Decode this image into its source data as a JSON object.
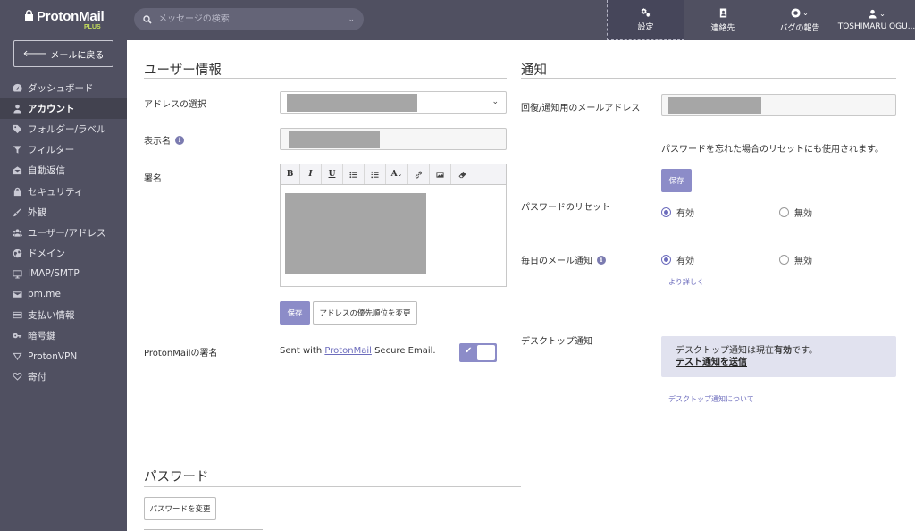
{
  "app": {
    "brand": "ProtonMail",
    "plan": "PLUS",
    "back_label": "メールに戻る"
  },
  "sidebar": {
    "items": [
      {
        "label": "ダッシュボード",
        "icon": "dashboard-icon",
        "active": false
      },
      {
        "label": "アカウント",
        "icon": "user-icon",
        "active": true
      },
      {
        "label": "フォルダー/ラベル",
        "icon": "tag-icon",
        "active": false
      },
      {
        "label": "フィルター",
        "icon": "filter-icon",
        "active": false
      },
      {
        "label": "自動返信",
        "icon": "envelope-open-icon",
        "active": false
      },
      {
        "label": "セキュリティ",
        "icon": "lock-icon",
        "active": false
      },
      {
        "label": "外観",
        "icon": "brush-icon",
        "active": false
      },
      {
        "label": "ユーザー/アドレス",
        "icon": "users-icon",
        "active": false
      },
      {
        "label": "ドメイン",
        "icon": "globe-icon",
        "active": false
      },
      {
        "label": "IMAP/SMTP",
        "icon": "monitor-icon",
        "active": false
      },
      {
        "label": "pm.me",
        "icon": "envelope-icon",
        "active": false
      },
      {
        "label": "支払い情報",
        "icon": "credit-card-icon",
        "active": false
      },
      {
        "label": "暗号鍵",
        "icon": "key-icon",
        "active": false
      },
      {
        "label": "ProtonVPN",
        "icon": "vpn-icon",
        "active": false
      },
      {
        "label": "寄付",
        "icon": "heart-icon",
        "active": false
      }
    ]
  },
  "topbar": {
    "search_placeholder": "メッセージの検索",
    "settings_label": "設定",
    "contacts_label": "連絡先",
    "bug_label": "バグの報告",
    "user_label": "TOSHIMARU OGU..."
  },
  "user_info": {
    "title": "ユーザー情報",
    "address_label": "アドレスの選択",
    "display_name_label": "表示名",
    "signature_label": "署名",
    "save_label": "保存",
    "address_priority_label": "アドレスの優先順位を変更",
    "protonmail_sig_label": "ProtonMailの署名",
    "sig_prefix": "Sent with ",
    "sig_link": "ProtonMail",
    "sig_suffix": " Secure Email.",
    "sig_toggle_on": true,
    "toolbar": [
      "B",
      "I",
      "U",
      "bullet-list-icon",
      "numbered-list-icon",
      "A",
      "link-icon",
      "image-icon",
      "eraser-icon"
    ]
  },
  "notifications": {
    "title": "通知",
    "recovery_email_label": "回復/通知用のメールアドレス",
    "recovery_hint": "パスワードを忘れた場合のリセットにも使用されます。",
    "save_label": "保存",
    "password_reset_label": "パスワードのリセット",
    "daily_label": "毎日のメール通知",
    "enabled_label": "有効",
    "disabled_label": "無効",
    "password_reset_value": "有効",
    "daily_value": "有効",
    "more_info": "より詳しく",
    "desktop_label": "デスクトップ通知",
    "desktop_status_prefix": "デスクトップ通知は現在",
    "desktop_status_value": "有効",
    "desktop_status_suffix": "です。",
    "send_test": "テスト通知を送信",
    "about_desktop": "デスクトップ通知について"
  },
  "password": {
    "title": "パスワード",
    "change_label": "パスワードを変更"
  }
}
